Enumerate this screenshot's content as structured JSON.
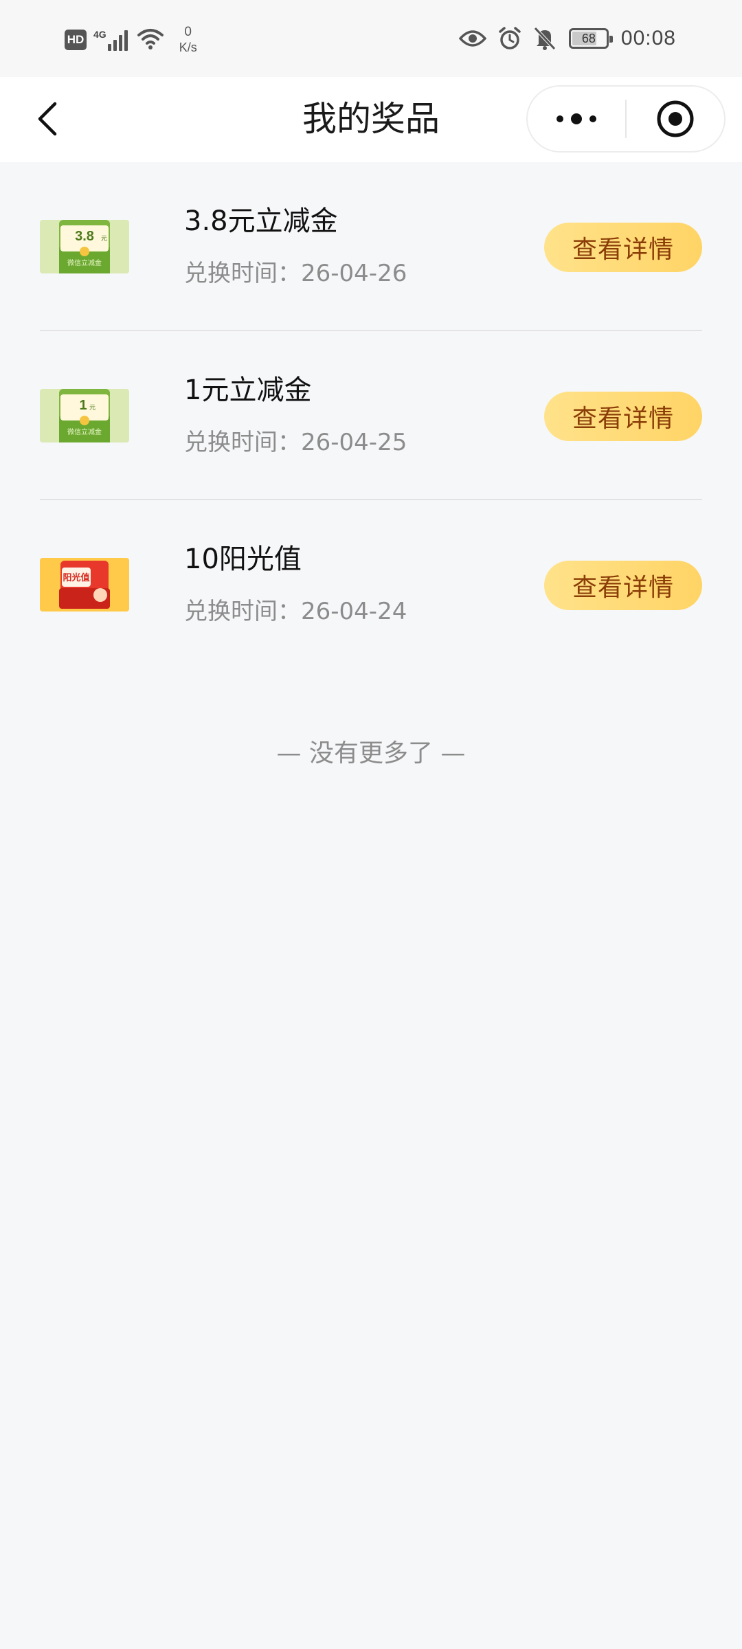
{
  "status_bar": {
    "hd": "HD",
    "network": "4G",
    "speed_value": "0",
    "speed_unit": "K/s",
    "battery": "68",
    "battery_level": 0.68,
    "time": "00:08",
    "icons": [
      "hd-icon",
      "signal-icon",
      "wifi-icon",
      "eye-icon",
      "alarm-icon",
      "mute-bell-icon",
      "battery-icon"
    ]
  },
  "nav": {
    "title": "我的奖品",
    "back_icon": "chevron-left-icon",
    "more_icon": "more-dots-icon",
    "close_icon": "target-circle-icon"
  },
  "prizes": [
    {
      "title": "3.8元立减金",
      "time_label": "兑换时间：",
      "time": "26-04-26",
      "button": "查看详情",
      "thumb": {
        "style": "green",
        "amount": "3.8",
        "unit": "元",
        "caption": "微信立减金"
      }
    },
    {
      "title": "1元立减金",
      "time_label": "兑换时间：",
      "time": "26-04-25",
      "button": "查看详情",
      "thumb": {
        "style": "green",
        "amount": "1",
        "unit": "元",
        "caption": "微信立减金"
      }
    },
    {
      "title": "10阳光值",
      "time_label": "兑换时间：",
      "time": "26-04-24",
      "button": "查看详情",
      "thumb": {
        "style": "orange",
        "label": "阳光值"
      }
    }
  ],
  "end_note": "— 没有更多了 —",
  "colors": {
    "background": "#f6f7f9",
    "button_gradient_start": "#ffe28a",
    "button_gradient_end": "#ffd466",
    "button_text": "#8a3d07"
  }
}
